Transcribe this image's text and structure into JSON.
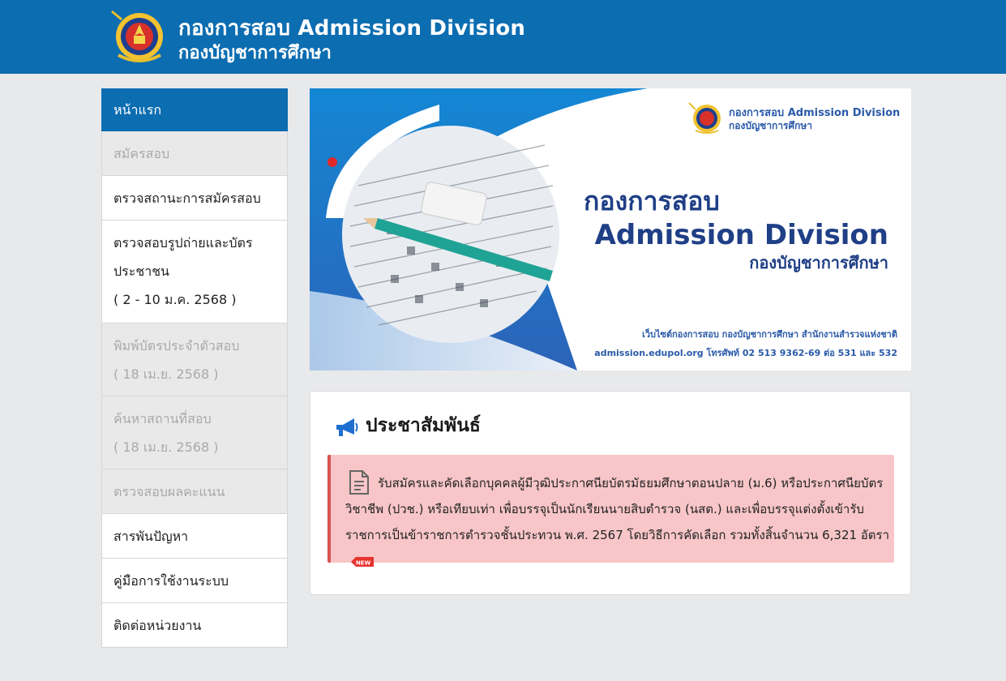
{
  "header": {
    "title_line1": "กองการสอบ Admission Division",
    "title_line2": "กองบัญชาการศึกษา",
    "logo_icon": "royal-thai-police-emblem",
    "bg_color": "#0c6db1"
  },
  "sidebar": {
    "items": [
      {
        "label": "หน้าแรก",
        "state": "active"
      },
      {
        "label": "สมัครสอบ",
        "state": "disabled"
      },
      {
        "label": "ตรวจสถานะการสมัครสอบ",
        "state": "enabled"
      },
      {
        "label": "ตรวจสอบรูปถ่ายและบัตร",
        "label2": "ประชาชน",
        "date": "( 2 - 10 ม.ค. 2568 )",
        "state": "enabled"
      },
      {
        "label": "พิมพ์บัตรประจำตัวสอบ",
        "date": "( 18 เม.ย. 2568 )",
        "state": "disabled"
      },
      {
        "label": "ค้นหาสถานที่สอบ",
        "date": "( 18 เม.ย. 2568 )",
        "state": "disabled"
      },
      {
        "label": "ตรวจสอบผลคะแนน",
        "state": "disabled"
      },
      {
        "label": "สารพันปัญหา",
        "state": "enabled"
      },
      {
        "label": "คู่มือการใช้งานระบบ",
        "state": "enabled"
      },
      {
        "label": "ติดต่อหน่วยงาน",
        "state": "enabled"
      }
    ]
  },
  "banner": {
    "logo_line1": "กองการสอบ Admission Division",
    "logo_line2": "กองบัญชาการศึกษา",
    "headline1": "กองการสอบ",
    "headline2": "Admission Division",
    "headline3": "กองบัญชาการศึกษา",
    "footer1": "เว็บไซต์กองการสอบ กองบัญชาการศึกษา สำนักงานสำรวจแห่งชาติ",
    "footer2": "admission.edupol.org  โทรศัพท์ 02 513 9362-69 ต่อ 531 และ 532"
  },
  "news": {
    "title": "ประชาสัมพันธ์",
    "title_icon": "megaphone-icon",
    "items": [
      {
        "text": "รับสมัครและคัดเลือกบุคคลผู้มีวุฒิประกาศนียบัตรมัธยมศึกษาตอนปลาย (ม.6) หรือประกาศนียบัตรวิชาชีพ (ปวช.) หรือเทียบเท่า เพื่อบรรจุเป็นนักเรียนนายสิบตำรวจ (นสต.) และเพื่อบรรจุแต่งตั้งเข้ารับราชการเป็นข้าราชการตำรวจชั้นประทวน พ.ศ. 2567 โดยวิธีการคัดเลือก รวมทั้งสิ้นจำนวน 6,321 อัตรา",
        "icon": "document-icon",
        "badge": "NEW"
      }
    ]
  }
}
